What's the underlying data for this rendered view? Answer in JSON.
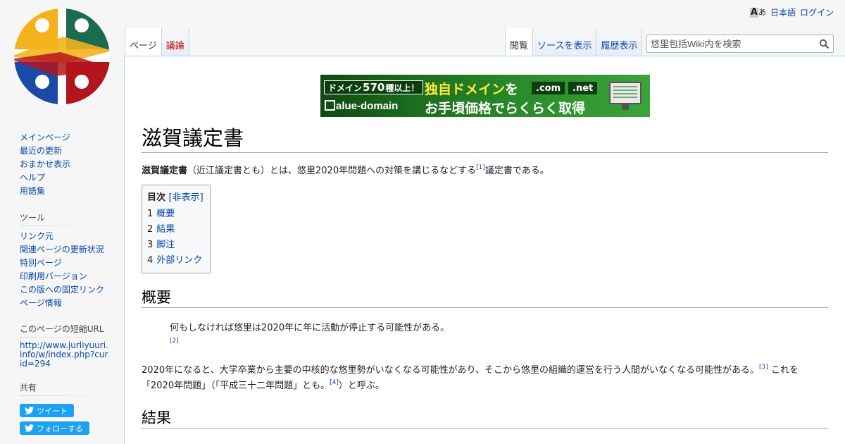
{
  "personal": {
    "lang_icon": "language-icon",
    "language": "日本語",
    "login": "ログイン"
  },
  "tabs_left": [
    "ページ",
    "議論"
  ],
  "tabs_right": [
    "閲覧",
    "ソースを表示",
    "履歴表示"
  ],
  "search": {
    "placeholder": "悠里包括Wiki内を検索",
    "icon": "search-icon"
  },
  "sidebar": {
    "navigation": [
      "メインページ",
      "最近の更新",
      "おまかせ表示",
      "ヘルプ",
      "用語集"
    ],
    "tools_heading": "ツール",
    "tools": [
      "リンク元",
      "関連ページの更新状況",
      "特別ページ",
      "印刷用バージョン",
      "この版への固定リンク",
      "ページ情報"
    ],
    "url_heading": "このページの短縮URL",
    "url": "http://www.jurliyuuri.info/w/index.php?curid=294",
    "share_heading": "共有",
    "tweet": "ツイート",
    "follow": "フォローする"
  },
  "ad": {
    "badge_pre": "ドメイン",
    "badge_num": "570",
    "badge_post": "種以上！",
    "brand": "alue-domain",
    "headline_yellow": "独自ドメイン",
    "headline_white": "を",
    "tld1": ".com",
    "tld2": ".net",
    "subline": "お手頃価格でらくらく取得"
  },
  "heading": "滋賀議定書",
  "intro": {
    "bold": "滋賀議定書",
    "text": "（近江議定書とも）とは、悠里2020年問題への対策を講じるなどする",
    "ref": "[1]",
    "tail": "議定書である。"
  },
  "toc": {
    "title": "目次",
    "toggle": "[非表示]",
    "items": [
      {
        "num": "1",
        "label": "概要"
      },
      {
        "num": "2",
        "label": "結果"
      },
      {
        "num": "3",
        "label": "脚注"
      },
      {
        "num": "4",
        "label": "外部リンク"
      }
    ]
  },
  "section1": {
    "title": "概要",
    "quote": "何もしなければ悠里は2020年に年に活動が停止する可能性がある。",
    "quote_ref": "[2]",
    "para_a": "2020年になると、大学卒業から主要の中核的な悠里勢がいなくなる可能性があり、そこから悠里の組織的運営を行う人間がいなくなる可能性がある。",
    "ref3": "[3]",
    "para_b": "これを「2020年問題」（「平成三十二年問題」とも。",
    "ref4": "[4]",
    "para_c": "）と呼ぶ。"
  },
  "section2": {
    "title": "結果"
  }
}
